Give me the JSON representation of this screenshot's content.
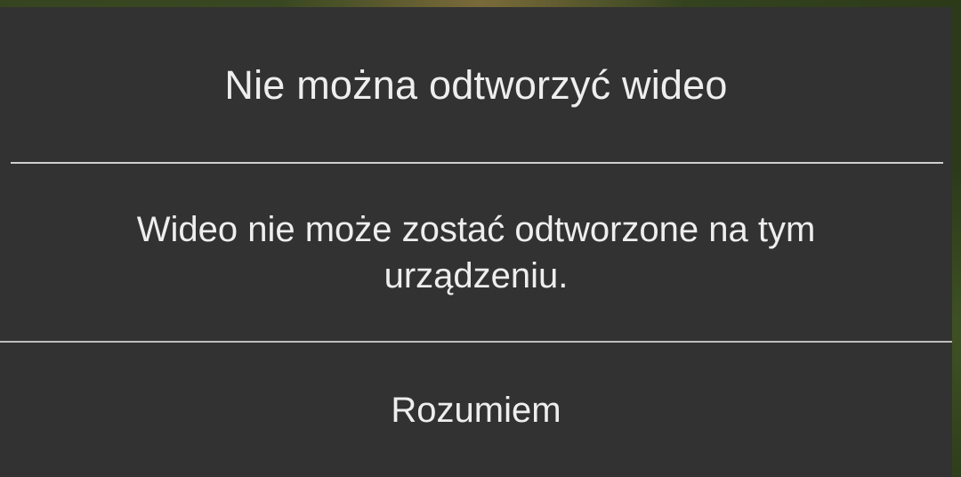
{
  "dialog": {
    "title": "Nie można odtworzyć wideo",
    "message": "Wideo nie może zostać odtworzone na tym urządzeniu.",
    "button_label": "Rozumiem"
  },
  "colors": {
    "dialog_background": "#323232",
    "text": "#eeeeee",
    "divider": "#cfcfcf"
  }
}
